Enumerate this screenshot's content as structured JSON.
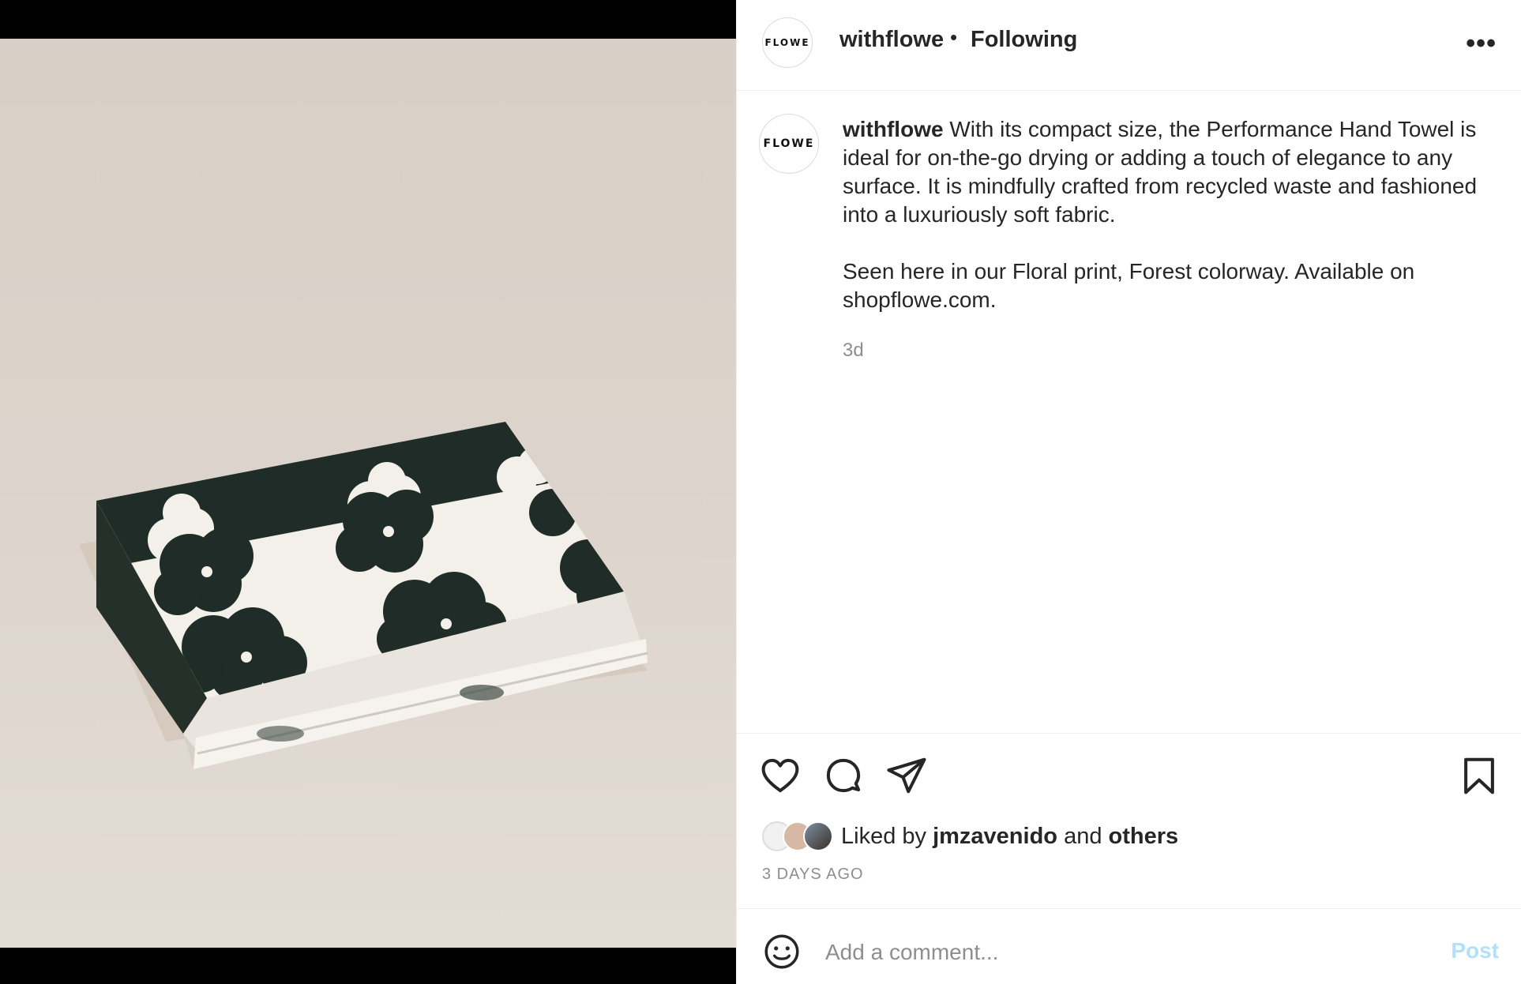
{
  "post": {
    "username": "withflowe",
    "avatar_text": "FLOWE",
    "follow_status": "Following",
    "more_icon": "more-options-icon"
  },
  "caption": {
    "username": "withflowe",
    "paragraph1": "With its compact size, the Performance Hand Towel is ideal for on-the-go drying or adding a touch of elegance to any surface. It is mindfully crafted from recycled waste and fashioned into a luxuriously soft fabric.",
    "paragraph2": "Seen here in our Floral print, Forest colorway. Available on shopflowe.com.",
    "time": "3d"
  },
  "actions": {
    "like_icon": "heart-icon",
    "comment_icon": "comment-bubble-icon",
    "share_icon": "paper-plane-icon",
    "save_icon": "bookmark-icon"
  },
  "likes": {
    "prefix": "Liked by",
    "user": "jmzavenido",
    "connector": "and",
    "others": "others"
  },
  "date": "3 DAYS AGO",
  "comment": {
    "placeholder": "Add a comment...",
    "post_label": "Post",
    "emoji_icon": "emoji-smiley-icon"
  },
  "colors": {
    "towel_ink": "#1f2c28",
    "towel_cloth": "#f2efe9",
    "backdrop": "#dcd3ca",
    "post_button": "#b2dffc"
  }
}
